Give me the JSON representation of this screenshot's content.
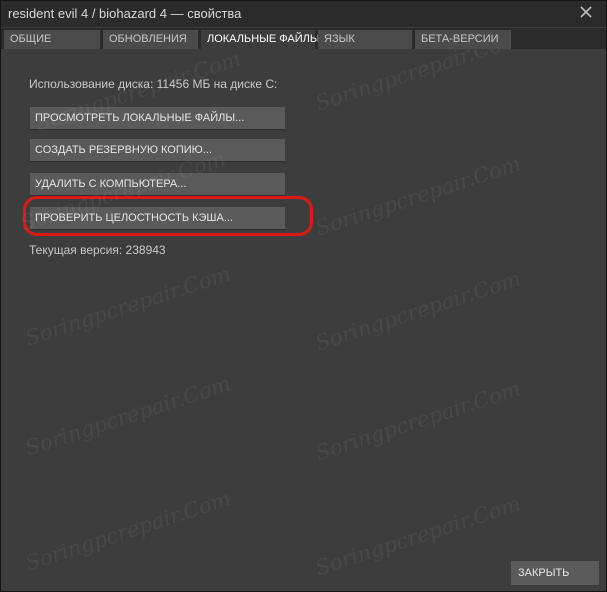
{
  "window": {
    "title": "resident evil 4 / biohazard 4 — свойства"
  },
  "tabs": [
    {
      "label": "ОБЩИЕ",
      "active": false
    },
    {
      "label": "ОБНОВЛЕНИЯ",
      "active": false
    },
    {
      "label": "ЛОКАЛЬНЫЕ ФАЙЛЫ",
      "active": true
    },
    {
      "label": "ЯЗЫК",
      "active": false
    },
    {
      "label": "БЕТА-ВЕРСИИ",
      "active": false
    }
  ],
  "local_files": {
    "disk_usage": "Использование диска: 11456 МБ на диске C:",
    "buttons": {
      "browse": "ПРОСМОТРЕТЬ ЛОКАЛЬНЫЕ ФАЙЛЫ...",
      "backup": "СОЗДАТЬ РЕЗЕРВНУЮ КОПИЮ...",
      "delete": "УДАЛИТЬ С КОМПЬЮТЕРА...",
      "verify": "ПРОВЕРИТЬ ЦЕЛОСТНОСТЬ КЭША..."
    },
    "current_version": "Текущая версия: 238943"
  },
  "footer": {
    "close_label": "ЗАКРЫТЬ"
  },
  "watermark": {
    "text": "Soringpcrepair.Com"
  },
  "colors": {
    "highlight_ring": "#e01717",
    "active_tab_bg": "#3d3d3d",
    "button_bg": "#5a5a5a"
  },
  "icons": {
    "window_close": "close-icon"
  }
}
